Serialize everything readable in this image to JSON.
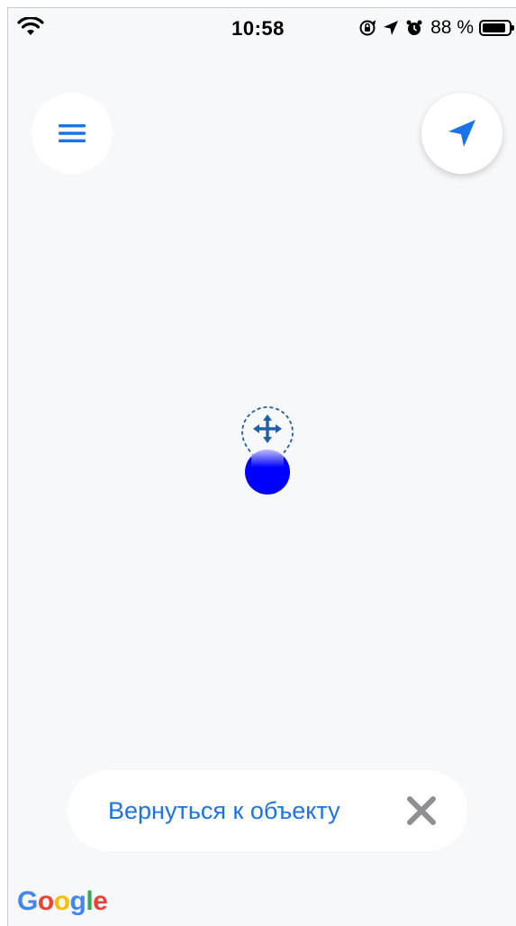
{
  "status_bar": {
    "time": "10:58",
    "battery_percent": "88 %",
    "battery_level": 0.88,
    "icons": [
      "wifi-icon",
      "orientation-lock-icon",
      "location-arrow-icon",
      "alarm-icon",
      "battery-icon"
    ]
  },
  "map": {
    "menu_button_icon": "hamburger-menu-icon",
    "locate_button_icon": "navigation-arrow-icon",
    "pin_icon": "move-arrows-icon",
    "accent_color": "#1a73e8",
    "dot_color": "#0000ff"
  },
  "return_bar": {
    "label": "Вернуться к объекту",
    "close_icon": "close-icon"
  },
  "attribution": {
    "logo_text": "Google",
    "logo_letters": [
      "G",
      "o",
      "o",
      "g",
      "l",
      "e"
    ],
    "logo_colors": [
      "#4285F4",
      "#EA4335",
      "#FBBC05",
      "#4285F4",
      "#34A853",
      "#EA4335"
    ]
  }
}
